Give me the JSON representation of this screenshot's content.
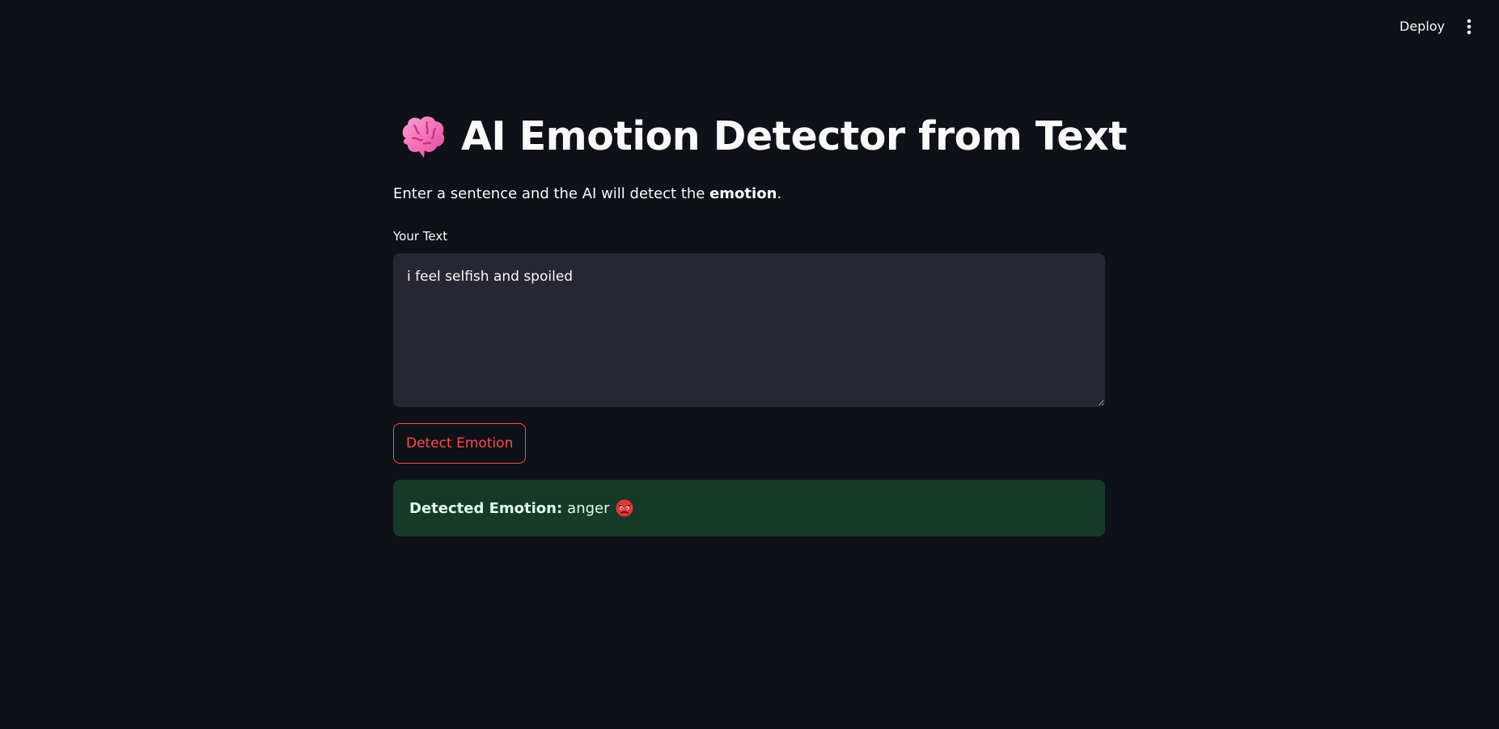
{
  "header": {
    "deploy_label": "Deploy",
    "menu_icon": "more-vertical-icon"
  },
  "main": {
    "title_icon": "brain-icon",
    "title": "AI Emotion Detector from Text",
    "subtitle_prefix": "Enter a sentence and the AI will detect the ",
    "subtitle_bold": "emotion",
    "subtitle_suffix": ".",
    "input_label": "Your Text",
    "input_value": "i feel selfish and spoiled",
    "button_label": "Detect Emotion",
    "result_label": "Detected Emotion:",
    "result_value": "anger",
    "result_icon": "angry-face-icon"
  },
  "colors": {
    "background": "#0e1117",
    "input_bg": "#262730",
    "accent": "#ff4b4b",
    "success_bg": "#173928",
    "text": "#fafafa"
  }
}
